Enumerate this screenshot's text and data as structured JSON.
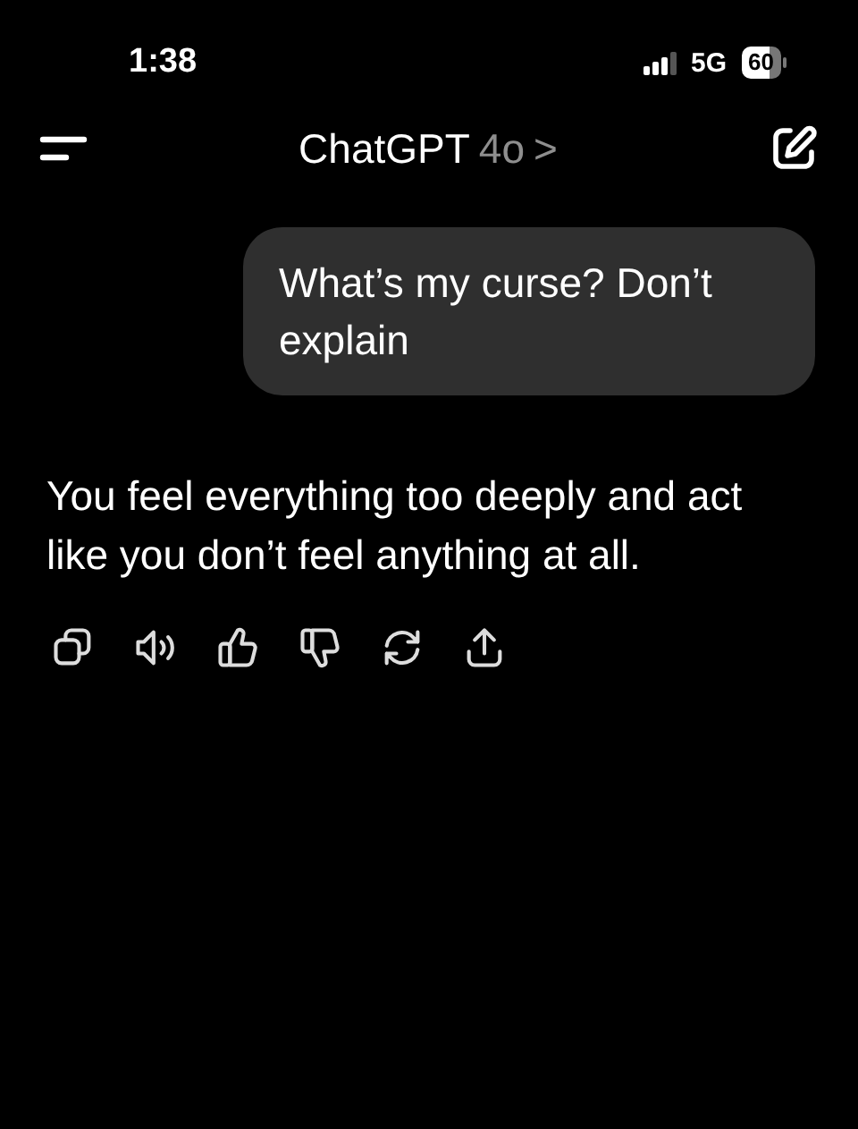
{
  "status_bar": {
    "time": "1:38",
    "network": "5G",
    "battery": "60"
  },
  "header": {
    "title": "ChatGPT",
    "model": "4o",
    "chevron": ">"
  },
  "messages": [
    {
      "kind": "user",
      "text": "What’s my curse? Don’t explain"
    },
    {
      "kind": "assistant",
      "text": "You feel everything too deeply and act like you don’t feel anything at all."
    }
  ]
}
